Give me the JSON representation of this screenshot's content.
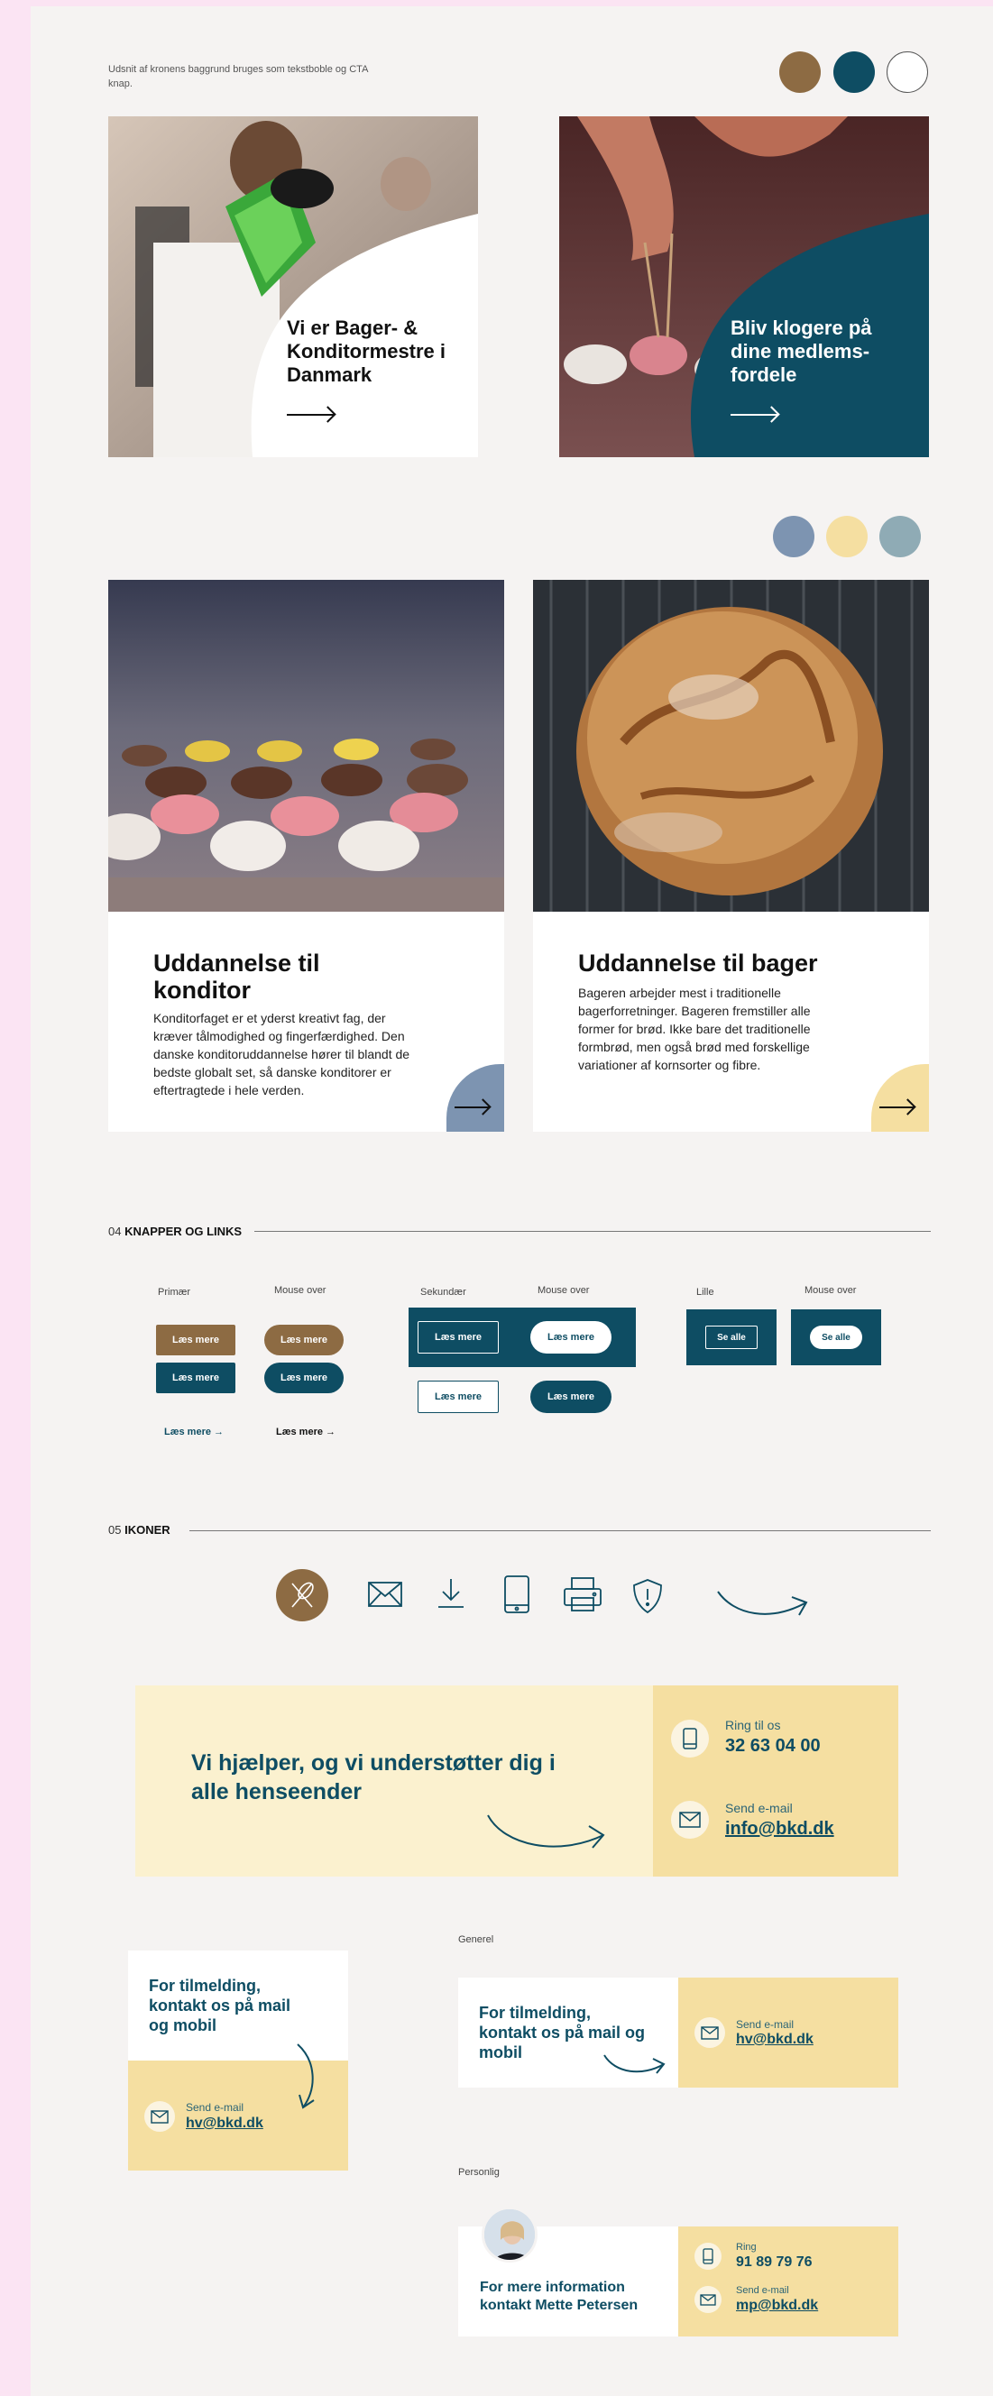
{
  "note": "Udsnit af kronens baggrund bruges som tekstboble og CTA knap.",
  "colors": {
    "brown": "#8d6b43",
    "teal": "#0e4d63",
    "white": "#ffffff",
    "blue_grey": "#7d94b1",
    "pale_yellow": "#f5dfa1",
    "grey_blue": "#8fabb5"
  },
  "cards": [
    {
      "title": "Vi er Bager- & Konditormestre i Danmark"
    },
    {
      "title": "Bliv klogere på dine medlems-fordele"
    }
  ],
  "education": [
    {
      "title": "Uddannelse til konditor",
      "body": "Konditorfaget er et yderst kreativt fag, der kræver tålmodighed og fingerfærdighed. Den danske konditoruddannelse hører til blandt de bedste globalt set, så danske konditorer er eftertragtede i hele verden."
    },
    {
      "title": "Uddannelse til bager",
      "body": "Bageren arbejder mest i traditionelle bagerforretninger. Bageren fremstiller alle former for brød. Ikke bare det traditionelle formbrød, men også brød med forskellige variationer af kornsorter og fibre."
    }
  ],
  "section_buttons": {
    "number": "04",
    "title": "KNAPPER OG LINKS"
  },
  "buttons": {
    "primary_label": "Primær",
    "secondary_label": "Sekundær",
    "small_label": "Lille",
    "hover_label": "Mouse over",
    "read_more": "Læs mere",
    "read_more_link": "Læs mere →",
    "see_all": "Se alle"
  },
  "section_icons": {
    "number": "05",
    "title": "IKONER"
  },
  "icons": [
    "whisk-icon",
    "mail-icon",
    "download-icon",
    "phone-icon",
    "printer-icon",
    "shield-icon",
    "curved-arrow-icon"
  ],
  "banner": {
    "heading": "Vi hjælper, og vi understøtter dig i alle henseender",
    "phone_label": "Ring til os",
    "phone": "32 63 04 00",
    "email_label": "Send e-mail",
    "email": "info@bkd.dk"
  },
  "general_label": "Generel",
  "personal_label": "Personlig",
  "signup": {
    "heading": "For tilmelding, kontakt os på mail og mobil",
    "email_label": "Send e-mail",
    "email": "hv@bkd.dk"
  },
  "personal": {
    "heading": "For mere information kontakt Mette Petersen",
    "phone_label": "Ring",
    "phone": "91 89 79 76",
    "email_label": "Send e-mail",
    "email": "mp@bkd.dk"
  }
}
